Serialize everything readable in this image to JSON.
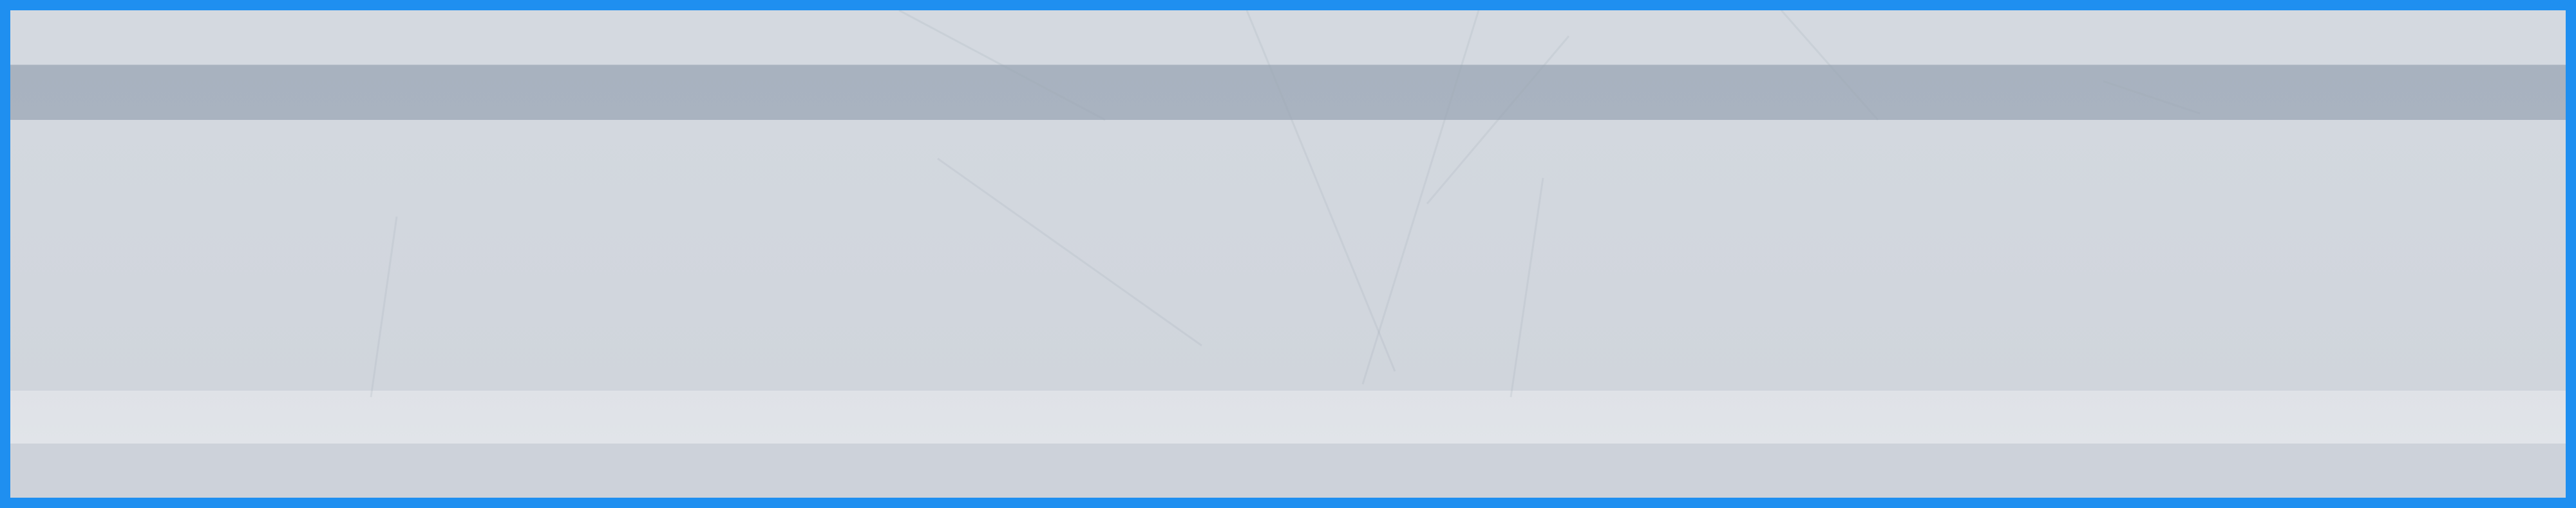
{
  "colors": {
    "border": "#1f8ff0",
    "band_top": "#d4d9e0",
    "band_dark": "#a8b2bf",
    "band_main": "#d1d6dd",
    "band_light": "#e0e3e8",
    "band_bottom": "#cdd2da"
  }
}
